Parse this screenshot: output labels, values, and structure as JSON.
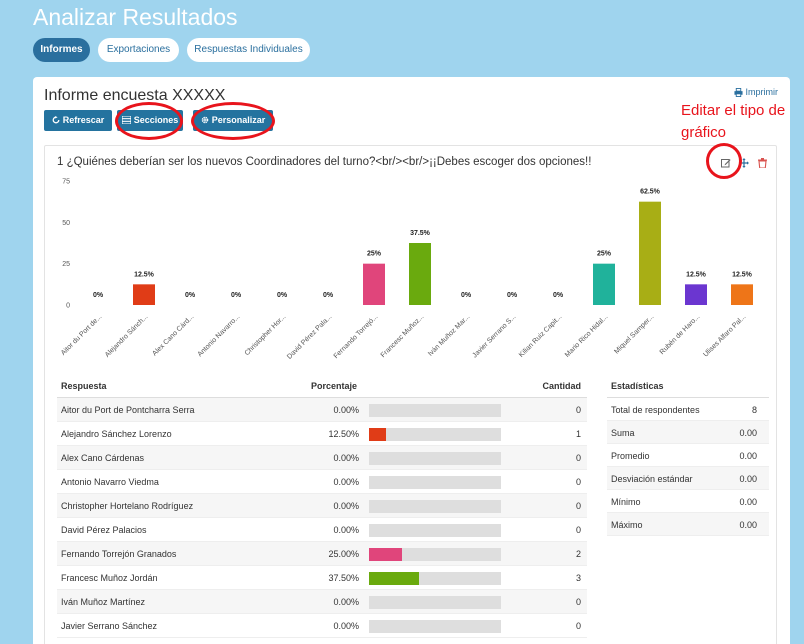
{
  "header": {
    "title": "Analizar Resultados"
  },
  "tabs": [
    {
      "label": "Informes",
      "active": true
    },
    {
      "label": "Exportaciones",
      "active": false
    },
    {
      "label": "Respuestas Individuales",
      "active": false
    }
  ],
  "report": {
    "title": "Informe encuesta XXXXX",
    "print_label": "Imprimir",
    "toolbar": {
      "refresh_label": "Refrescar",
      "sections_label": "Secciones",
      "customize_label": "Personalizar"
    }
  },
  "annotation": {
    "text": "Editar el tipo de gráfico",
    "color": "#e8141c"
  },
  "question": {
    "text": "1 ¿Quiénes deberían ser los nuevos Coordinadores del turno?<br/><br/>¡¡Debes escoger dos opciones!!"
  },
  "chart_data": {
    "type": "bar",
    "categories": [
      "Aitor du Port de...",
      "Alejandro Sánch...",
      "Alex Cano Cárd...",
      "Antonio Navarro...",
      "Christopher Hor...",
      "David Pérez Pala...",
      "Fernando Torrejó...",
      "Francesc Muñoz...",
      "Iván Muñoz Mar...",
      "Javier Serrano S...",
      "Kilian Ruiz Capit...",
      "Mario Rico Hidal...",
      "Miquel Samper...",
      "Rubén de Haro...",
      "Ulises Alfaro Pal..."
    ],
    "values": [
      0,
      1,
      0,
      0,
      0,
      0,
      2,
      3,
      0,
      0,
      0,
      2,
      5,
      1,
      1
    ],
    "data_labels": [
      "0%",
      "12.5%",
      "0%",
      "0%",
      "0%",
      "0%",
      "25%",
      "37.5%",
      "0%",
      "0%",
      "0%",
      "25%",
      "62.5%",
      "12.5%",
      "12.5%"
    ],
    "colors": [
      "#cccccc",
      "#e03c17",
      "#cccccc",
      "#cccccc",
      "#cccccc",
      "#cccccc",
      "#e0457b",
      "#6aaa0e",
      "#cccccc",
      "#cccccc",
      "#cccccc",
      "#20b29b",
      "#a8ae15",
      "#6b36d0",
      "#ee7518"
    ],
    "yticks": [
      "75",
      "50",
      "25",
      "0"
    ],
    "ylim": [
      0,
      6
    ],
    "ytick_values": [
      6,
      4,
      2,
      0
    ],
    "grid": false
  },
  "responses": {
    "headers": {
      "answer": "Respuesta",
      "percent": "Porcentaje",
      "count": "Cantidad"
    },
    "rows": [
      {
        "name": "Aitor du Port de Pontcharra Serra",
        "pct": "0.00%",
        "frac": 0,
        "count": "0",
        "color": "#cccccc"
      },
      {
        "name": "Alejandro Sánchez Lorenzo",
        "pct": "12.50%",
        "frac": 0.125,
        "count": "1",
        "color": "#e03c17"
      },
      {
        "name": "Alex Cano Cárdenas",
        "pct": "0.00%",
        "frac": 0,
        "count": "0",
        "color": "#cccccc"
      },
      {
        "name": "Antonio Navarro Viedma",
        "pct": "0.00%",
        "frac": 0,
        "count": "0",
        "color": "#cccccc"
      },
      {
        "name": "Christopher Hortelano Rodríguez",
        "pct": "0.00%",
        "frac": 0,
        "count": "0",
        "color": "#cccccc"
      },
      {
        "name": "David Pérez Palacios",
        "pct": "0.00%",
        "frac": 0,
        "count": "0",
        "color": "#cccccc"
      },
      {
        "name": "Fernando Torrejón Granados",
        "pct": "25.00%",
        "frac": 0.25,
        "count": "2",
        "color": "#e0457b"
      },
      {
        "name": "Francesc Muñoz Jordán",
        "pct": "37.50%",
        "frac": 0.375,
        "count": "3",
        "color": "#6aaa0e"
      },
      {
        "name": "Iván Muñoz Martínez",
        "pct": "0.00%",
        "frac": 0,
        "count": "0",
        "color": "#cccccc"
      },
      {
        "name": "Javier Serrano Sánchez",
        "pct": "0.00%",
        "frac": 0,
        "count": "0",
        "color": "#cccccc"
      }
    ]
  },
  "stats": {
    "title": "Estadísticas",
    "rows": [
      {
        "label": "Total de respondentes",
        "value": "8"
      },
      {
        "label": "Suma",
        "value": "0.00"
      },
      {
        "label": "Promedio",
        "value": "0.00"
      },
      {
        "label": "Desviación estándar",
        "value": "0.00"
      },
      {
        "label": "Mínimo",
        "value": "0.00"
      },
      {
        "label": "Máximo",
        "value": "0.00"
      }
    ]
  }
}
